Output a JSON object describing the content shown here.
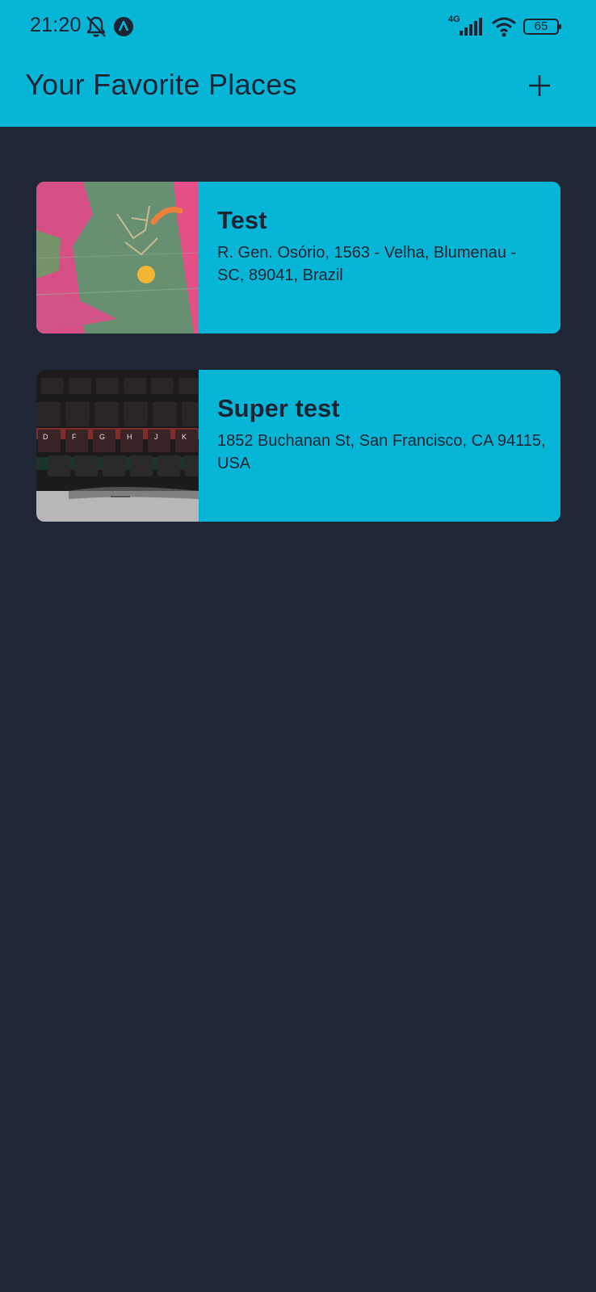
{
  "status_bar": {
    "time": "21:20",
    "network": "4G",
    "battery": "65"
  },
  "app_bar": {
    "title": "Your Favorite Places",
    "add_icon": "plus-icon"
  },
  "places": [
    {
      "title": "Test",
      "address": "R. Gen. Osório, 1563 - Velha, Blumenau - SC, 89041, Brazil"
    },
    {
      "title": "Super test",
      "address": "1852 Buchanan St, San Francisco, CA 94115, USA"
    }
  ],
  "colors": {
    "app_bar": "#07b6d6",
    "background": "#1f2736",
    "card": "#07b6d6",
    "text": "#1c2433"
  }
}
